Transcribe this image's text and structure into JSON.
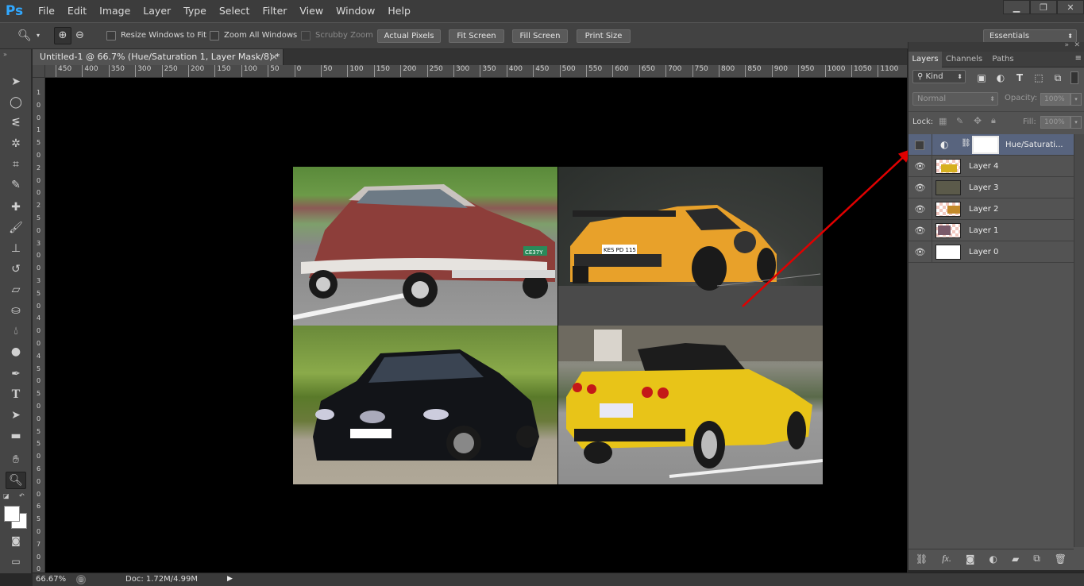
{
  "app": {
    "logo": "Ps"
  },
  "menu": [
    "File",
    "Edit",
    "Image",
    "Layer",
    "Type",
    "Select",
    "Filter",
    "View",
    "Window",
    "Help"
  ],
  "options": {
    "resize_windows": "Resize Windows to Fit",
    "zoom_all": "Zoom All Windows",
    "scrubby_zoom": "Scrubby Zoom",
    "actual_pixels": "Actual Pixels",
    "fit_screen": "Fit Screen",
    "fill_screen": "Fill Screen",
    "print_size": "Print Size",
    "workspace": "Essentials"
  },
  "document": {
    "tab_title": "Untitled-1 @ 66.7% (Hue/Saturation 1, Layer Mask/8) *",
    "close": "×"
  },
  "ruler": {
    "top": [
      "450",
      "400",
      "350",
      "300",
      "250",
      "200",
      "150",
      "100",
      "50",
      "0",
      "50",
      "100",
      "150",
      "200",
      "250",
      "300",
      "350",
      "400",
      "450",
      "500",
      "550",
      "600",
      "650",
      "700",
      "750",
      "800",
      "850",
      "900",
      "950",
      "1000",
      "1050",
      "1100"
    ],
    "left": [
      "1",
      "0",
      "0",
      "1",
      "5",
      "0",
      "2",
      "0",
      "0",
      "2",
      "5",
      "0",
      "3",
      "0",
      "0",
      "3",
      "5",
      "0",
      "4",
      "0",
      "0",
      "4",
      "5",
      "0",
      "5",
      "0",
      "0",
      "5",
      "5",
      "0",
      "6",
      "0",
      "0",
      "6",
      "5",
      "0",
      "7",
      "0",
      "0"
    ]
  },
  "status": {
    "zoom": "66.67%",
    "doc": "Doc: 1.72M/4.99M"
  },
  "panel": {
    "tabs": [
      "Layers",
      "Channels",
      "Paths"
    ],
    "filter_kind": "Kind",
    "blend_mode": "Normal",
    "opacity_label": "Opacity:",
    "opacity_value": "100%",
    "lock_label": "Lock:",
    "fill_label": "Fill:",
    "fill_value": "100%",
    "layers": [
      {
        "name": "Hue/Saturati...",
        "visible": false,
        "selected": true,
        "type": "adjustment"
      },
      {
        "name": "Layer 4",
        "visible": true,
        "selected": false,
        "type": "pixel"
      },
      {
        "name": "Layer 3",
        "visible": true,
        "selected": false,
        "type": "pixel"
      },
      {
        "name": "Layer 2",
        "visible": true,
        "selected": false,
        "type": "pixel"
      },
      {
        "name": "Layer 1",
        "visible": true,
        "selected": false,
        "type": "pixel"
      },
      {
        "name": "Layer 0",
        "visible": true,
        "selected": false,
        "type": "white"
      }
    ]
  },
  "canvas": {
    "photos": [
      "classic-red-car",
      "orange-audi-r8",
      "black-mercedes-coupe",
      "yellow-corvette"
    ],
    "plate_audi": "KES PD 115",
    "plate_classic": "CE37Y"
  },
  "colors": {
    "accent_blue": "#31a8ff",
    "arrow_red": "#e00000",
    "selected_layer": "#58647e"
  }
}
